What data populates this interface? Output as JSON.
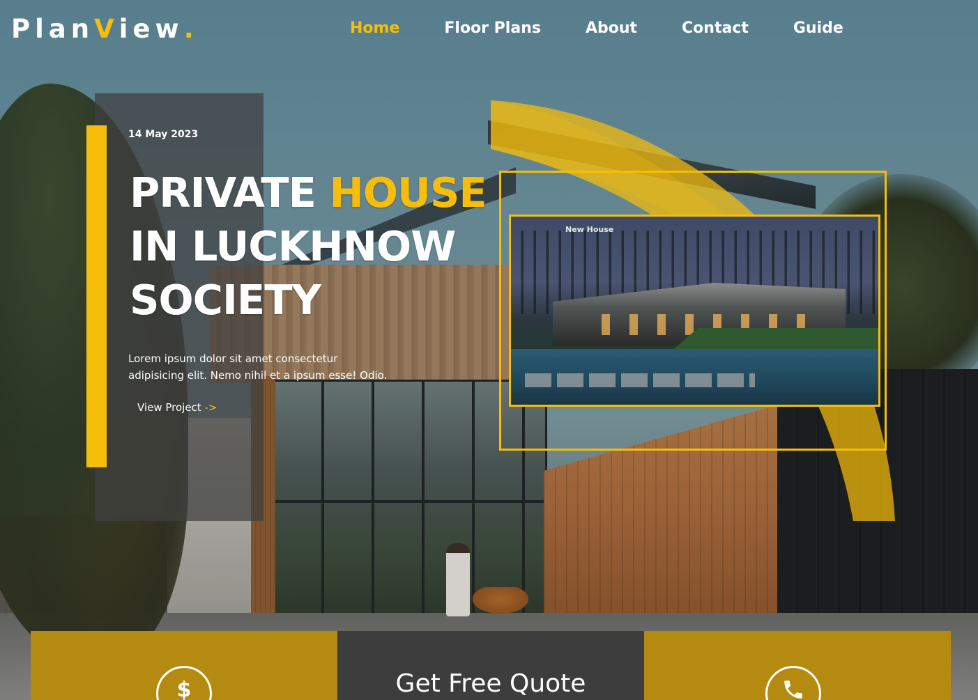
{
  "brand": {
    "logo_part1": "Plan",
    "logo_accent1": "V",
    "logo_part2": "iew",
    "logo_dot": ".",
    "accent_color": "#f6be0a"
  },
  "nav": {
    "items": [
      {
        "label": "Home",
        "active": true
      },
      {
        "label": "Floor Plans",
        "active": false
      },
      {
        "label": "About",
        "active": false
      },
      {
        "label": "Contact",
        "active": false
      },
      {
        "label": "Guide",
        "active": false
      }
    ]
  },
  "hero": {
    "date": "14 May 2023",
    "title_line1_a": "PRIVATE ",
    "title_line1_b": "HOUSE",
    "title_line2": "IN LUCKHNOW",
    "title_line3": "SOCIETY",
    "description": "Lorem ipsum dolor sit amet consectetur adipisicing elit. Nemo nihil et a ipsum esse! Odio.",
    "link_label": "View Project",
    "link_arrow": "->"
  },
  "preview": {
    "label": "New House"
  },
  "bottom_strip": {
    "left_icon": "dollar-icon",
    "left_icon_glyph": "$",
    "cta_label": "Get Free Quote",
    "right_icon": "phone-icon",
    "gold_color": "#b48a10",
    "dark_color": "#3d3d3d"
  }
}
